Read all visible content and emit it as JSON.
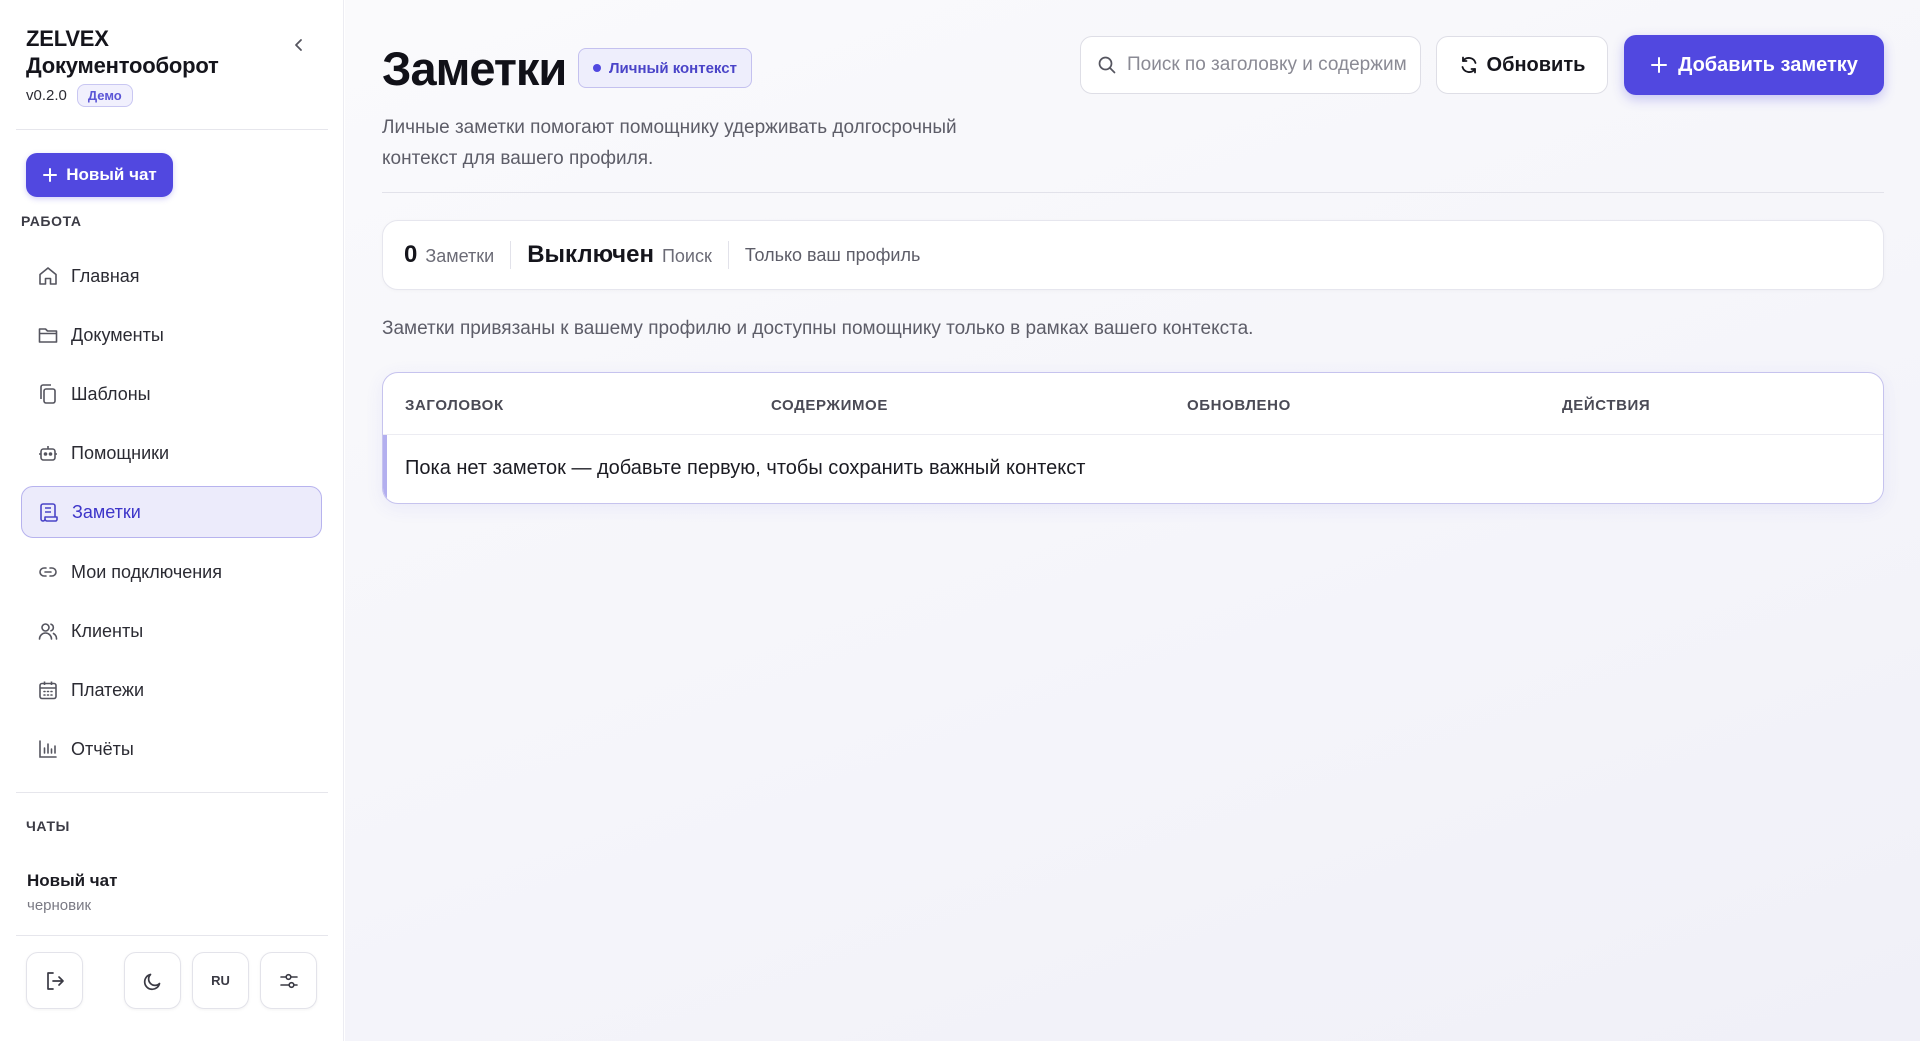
{
  "app": {
    "brand_line1": "ZELVEX",
    "brand_line2": "Документооборот",
    "version": "v0.2.0",
    "badge": "Демо"
  },
  "sidebar": {
    "new_chat_label": "Новый чат",
    "section_work": "РАБОТА",
    "items": [
      {
        "label": "Главная",
        "icon": "home-icon"
      },
      {
        "label": "Документы",
        "icon": "folder-icon"
      },
      {
        "label": "Шаблоны",
        "icon": "copy-icon"
      },
      {
        "label": "Помощники",
        "icon": "bot-icon"
      },
      {
        "label": "Заметки",
        "icon": "notes-icon",
        "active": true
      },
      {
        "label": "Мои подключения",
        "icon": "link-icon"
      },
      {
        "label": "Клиенты",
        "icon": "users-icon"
      },
      {
        "label": "Платежи",
        "icon": "calendar-icon"
      },
      {
        "label": "Отчёты",
        "icon": "bar-chart-icon"
      }
    ],
    "section_chats": "ЧАТЫ",
    "chat": {
      "title": "Новый чат",
      "subtitle": "черновик"
    },
    "bottom": {
      "lang": "RU"
    }
  },
  "main": {
    "title": "Заметки",
    "context_badge": "Личный контекст",
    "description": "Личные заметки помогают помощнику удерживать долгосрочный контекст для вашего профиля.",
    "search_placeholder": "Поиск по заголовку и содержимому",
    "refresh_label": "Обновить",
    "add_label": "Добавить заметку",
    "stats": {
      "count_value": "0",
      "count_label": "Заметки",
      "search_value": "Выключен",
      "search_label": "Поиск",
      "scope": "Только ваш профиль"
    },
    "info": "Заметки привязаны к вашему профилю и доступны помощнику только в рамках вашего контекста.",
    "table": {
      "columns": [
        "ЗАГОЛОВОК",
        "СОДЕРЖИМОЕ",
        "ОБНОВЛЕНО",
        "ДЕЙСТВИЯ"
      ],
      "empty": "Пока нет заметок — добавьте первую, чтобы сохранить важный контекст"
    }
  },
  "colors": {
    "accent": "#5148e0",
    "accent_soft": "#ecebfb",
    "text": "#1b1b22",
    "muted": "#5d5d68"
  }
}
